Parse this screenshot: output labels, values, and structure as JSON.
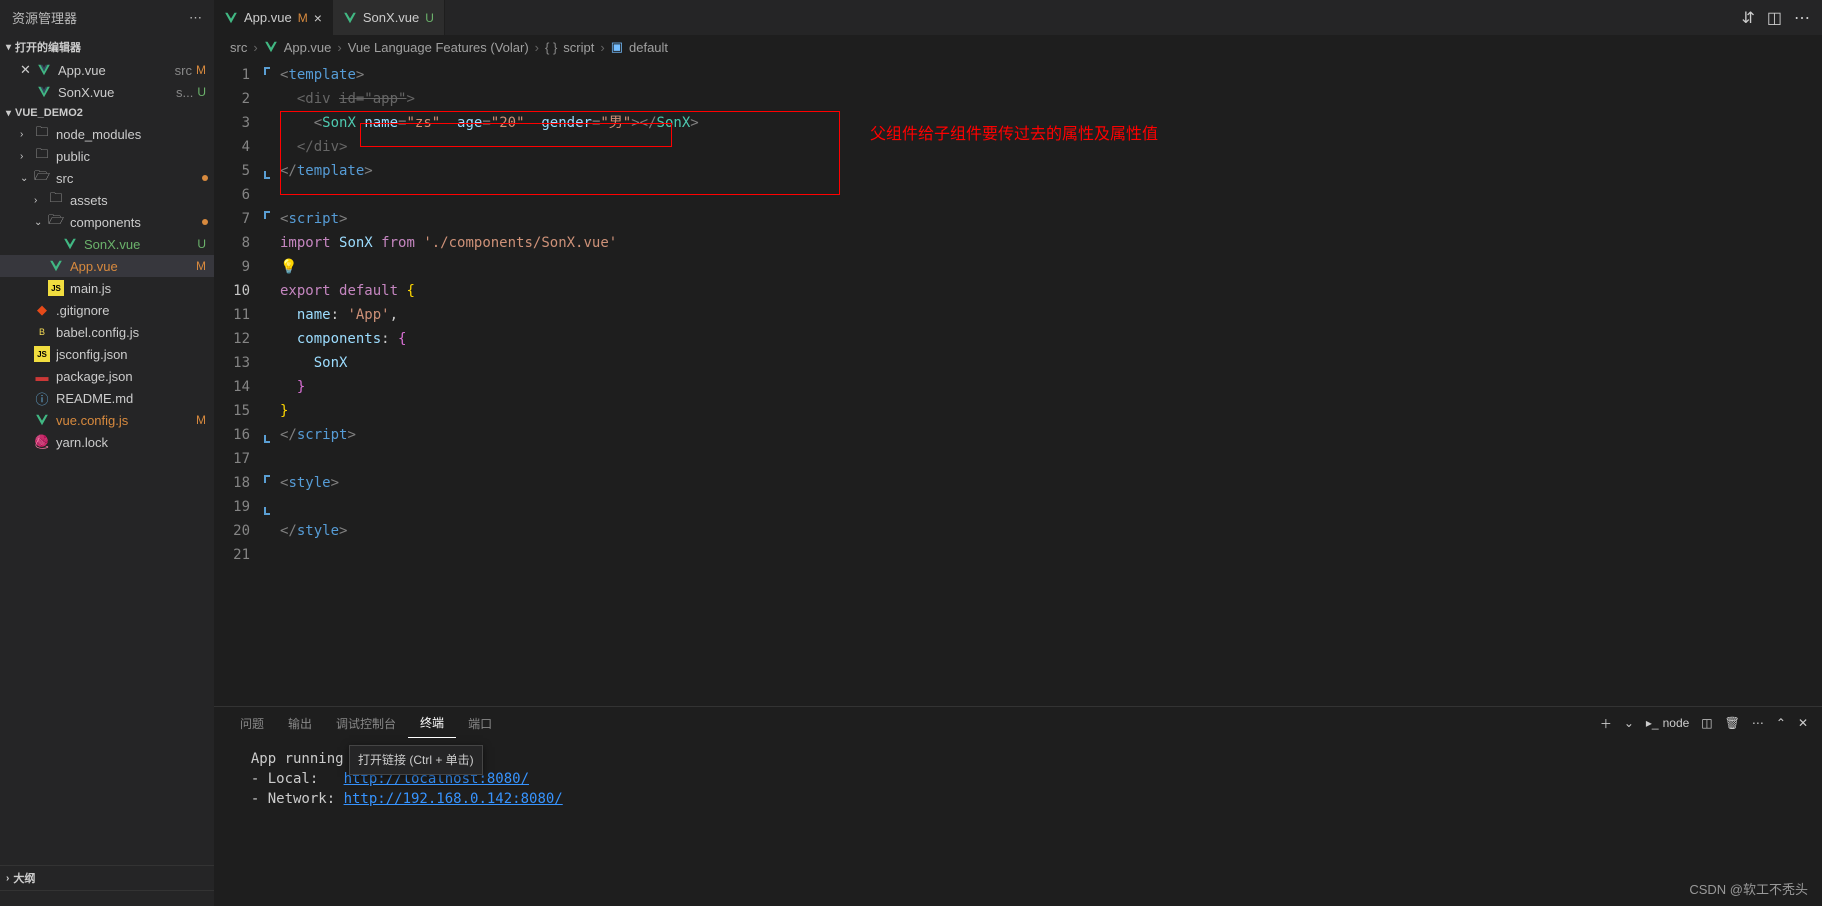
{
  "sidebar": {
    "title": "资源管理器",
    "open_editors": {
      "title": "打开的编辑器",
      "items": [
        {
          "name": "App.vue",
          "path": "src",
          "status": "M"
        },
        {
          "name": "SonX.vue",
          "path": "s...",
          "status": "U"
        }
      ]
    },
    "project": {
      "name": "VUE_DEMO2",
      "tree": [
        {
          "type": "folder",
          "name": "node_modules",
          "depth": 1,
          "expanded": false
        },
        {
          "type": "folder",
          "name": "public",
          "depth": 1,
          "expanded": false
        },
        {
          "type": "folder",
          "name": "src",
          "depth": 1,
          "expanded": true,
          "dot": true
        },
        {
          "type": "folder",
          "name": "assets",
          "depth": 2,
          "expanded": false
        },
        {
          "type": "folder",
          "name": "components",
          "depth": 2,
          "expanded": true,
          "dot": true
        },
        {
          "type": "file",
          "name": "SonX.vue",
          "depth": 3,
          "icon": "vue",
          "status": "U"
        },
        {
          "type": "file",
          "name": "App.vue",
          "depth": 2,
          "icon": "vue",
          "status": "M",
          "active": true
        },
        {
          "type": "file",
          "name": "main.js",
          "depth": 2,
          "icon": "js"
        },
        {
          "type": "file",
          "name": ".gitignore",
          "depth": 1,
          "icon": "git"
        },
        {
          "type": "file",
          "name": "babel.config.js",
          "depth": 1,
          "icon": "babel"
        },
        {
          "type": "file",
          "name": "jsconfig.json",
          "depth": 1,
          "icon": "js"
        },
        {
          "type": "file",
          "name": "package.json",
          "depth": 1,
          "icon": "npm"
        },
        {
          "type": "file",
          "name": "README.md",
          "depth": 1,
          "icon": "md"
        },
        {
          "type": "file",
          "name": "vue.config.js",
          "depth": 1,
          "icon": "vue",
          "status": "M"
        },
        {
          "type": "file",
          "name": "yarn.lock",
          "depth": 1,
          "icon": "yarn"
        }
      ]
    },
    "outline": "大纲"
  },
  "tabs": [
    {
      "name": "App.vue",
      "status": "M",
      "active": true
    },
    {
      "name": "SonX.vue",
      "status": "U",
      "active": false
    }
  ],
  "breadcrumb": [
    "src",
    "App.vue",
    "Vue Language Features (Volar)",
    "script",
    "default"
  ],
  "annotation": "父组件给子组件要传过去的属性及属性值",
  "code": {
    "lines": 21,
    "current_line": 10
  },
  "panel": {
    "tabs": [
      "问题",
      "输出",
      "调试控制台",
      "终端",
      "端口"
    ],
    "active": "终端",
    "shell": "node",
    "terminal": {
      "tooltip": "打开链接 (Ctrl + 单击)",
      "line1_pre": "  App running",
      "line2_pre": "  - Local:   ",
      "line2_link": "http://localhost:8080/",
      "line3_pre": "  - Network: ",
      "line3_link": "http://192.168.0.142:8080/"
    }
  },
  "watermark": "CSDN @软工不秃头"
}
